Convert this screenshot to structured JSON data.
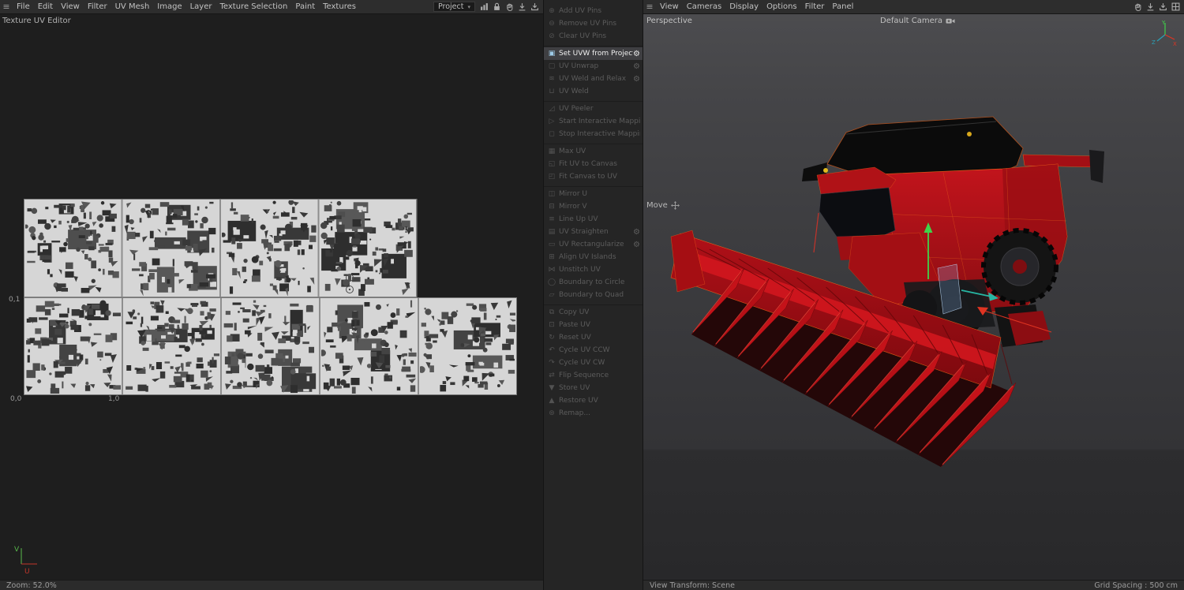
{
  "colors": {
    "accent_orange": "#ff6d1a",
    "body_red": "#b5121a",
    "selection_highlight": "#9ecbe8",
    "axis_x_red": "#e03422",
    "axis_y_green": "#3fd24a",
    "axis_z_teal": "#27b6a3",
    "uv_tile_bg": "#d6d6d6",
    "uv_island_dark": "#3a3a3a"
  },
  "glyphs": {
    "hamburger": "≡",
    "caret": "▾",
    "gear": "⚙"
  },
  "left_menubar": {
    "items": [
      "File",
      "Edit",
      "View",
      "Filter",
      "UV Mesh",
      "Image",
      "Layer",
      "Texture Selection",
      "Paint",
      "Textures"
    ],
    "project_dropdown": "Project",
    "icons": [
      "chart-icon",
      "lock-icon",
      "hand-icon",
      "download-arrow-icon",
      "save-arrow-icon"
    ]
  },
  "right_menubar": {
    "items": [
      "View",
      "Cameras",
      "Display",
      "Options",
      "Filter",
      "Panel"
    ],
    "icons": [
      "hand-icon",
      "download-arrow-icon",
      "save-arrow-icon",
      "layout-icon"
    ]
  },
  "uv_editor": {
    "title": "Texture UV Editor",
    "zoom_status": "Zoom: 52.0%",
    "axis_labels": {
      "v1": "0,1",
      "origin": "0,0",
      "u1": "1,0"
    },
    "gizmo": {
      "v": "V",
      "u": "U"
    },
    "tiles": {
      "upper_row": 4,
      "lower_row": 5
    }
  },
  "uv_commands": {
    "groups": [
      [
        {
          "label": "Add UV Pins",
          "icon": "⊕",
          "state": "disabled",
          "gear": false
        },
        {
          "label": "Remove UV Pins",
          "icon": "⊖",
          "state": "disabled",
          "gear": false
        },
        {
          "label": "Clear UV Pins",
          "icon": "⊘",
          "state": "disabled",
          "gear": false
        }
      ],
      [
        {
          "label": "Set UVW from Projection",
          "icon": "▣",
          "state": "selected",
          "gear": true
        },
        {
          "label": "UV Unwrap",
          "icon": "▢",
          "state": "disabled",
          "gear": true
        },
        {
          "label": "UV Weld and Relax",
          "icon": "≋",
          "state": "disabled",
          "gear": true
        },
        {
          "label": "UV Weld",
          "icon": "⊔",
          "state": "disabled",
          "gear": false
        }
      ],
      [
        {
          "label": "UV Peeler",
          "icon": "◿",
          "state": "disabled",
          "gear": false
        },
        {
          "label": "Start Interactive Mapping",
          "icon": "▷",
          "state": "disabled",
          "gear": false
        },
        {
          "label": "Stop Interactive Mapping",
          "icon": "◻",
          "state": "disabled",
          "gear": false
        }
      ],
      [
        {
          "label": "Max UV",
          "icon": "▦",
          "state": "disabled",
          "gear": false
        },
        {
          "label": "Fit UV to Canvas",
          "icon": "◱",
          "state": "disabled",
          "gear": false
        },
        {
          "label": "Fit Canvas to UV",
          "icon": "◰",
          "state": "disabled",
          "gear": false
        }
      ],
      [
        {
          "label": "Mirror U",
          "icon": "◫",
          "state": "disabled",
          "gear": false
        },
        {
          "label": "Mirror V",
          "icon": "⊟",
          "state": "disabled",
          "gear": false
        },
        {
          "label": "Line Up UV",
          "icon": "≡",
          "state": "disabled",
          "gear": false
        },
        {
          "label": "UV Straighten",
          "icon": "▤",
          "state": "disabled",
          "gear": true
        },
        {
          "label": "UV Rectangularize",
          "icon": "▭",
          "state": "disabled",
          "gear": true
        },
        {
          "label": "Align UV Islands",
          "icon": "⊞",
          "state": "disabled",
          "gear": false
        },
        {
          "label": "Unstitch UV",
          "icon": "⋈",
          "state": "disabled",
          "gear": false
        },
        {
          "label": "Boundary to Circle",
          "icon": "◯",
          "state": "disabled",
          "gear": false
        },
        {
          "label": "Boundary to Quad",
          "icon": "▱",
          "state": "disabled",
          "gear": false
        }
      ],
      [
        {
          "label": "Copy UV",
          "icon": "⧉",
          "state": "disabled",
          "gear": false
        },
        {
          "label": "Paste UV",
          "icon": "⊡",
          "state": "disabled",
          "gear": false
        },
        {
          "label": "Reset UV",
          "icon": "↻",
          "state": "disabled",
          "gear": false
        },
        {
          "label": "Cycle UV CCW",
          "icon": "↶",
          "state": "disabled",
          "gear": false
        },
        {
          "label": "Cycle UV CW",
          "icon": "↷",
          "state": "disabled",
          "gear": false
        },
        {
          "label": "Flip Sequence",
          "icon": "⇄",
          "state": "disabled",
          "gear": false
        },
        {
          "label": "Store UV",
          "icon": "▼",
          "state": "disabled",
          "gear": false
        },
        {
          "label": "Restore UV",
          "icon": "▲",
          "state": "disabled",
          "gear": false
        },
        {
          "label": "Remap...",
          "icon": "⊛",
          "state": "disabled",
          "gear": false
        }
      ]
    ]
  },
  "viewport": {
    "view_label": "Perspective",
    "camera_label": "Default Camera",
    "tool_hint": "Move",
    "status_left": "View Transform: Scene",
    "status_right": "Grid Spacing : 500 cm",
    "axis_gizmo": {
      "x": "X",
      "y": "Y",
      "z": "Z"
    }
  }
}
